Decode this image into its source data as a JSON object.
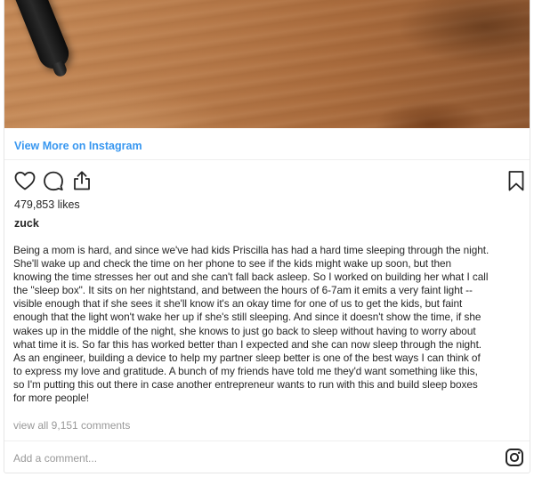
{
  "embed": {
    "view_more_label": "View More on Instagram",
    "likes_text": "479,853 likes",
    "username": "zuck",
    "caption": "Being a mom is hard, and since we've had kids Priscilla has had a hard time sleeping through the night.\nShe'll wake up and check the time on her phone to see if the kids might wake up soon, but then\nknowing the time stresses her out and she can't fall back asleep. So I worked on building her what I call\nthe \"sleep box\". It sits on her nightstand, and between the hours of 6-7am it emits a very faint light --\nvisible enough that if she sees it she'll know it's an okay time for one of us to get the kids, but faint\nenough that the light won't wake her up if she's still sleeping. And since it doesn't show the time, if she\nwakes up in the middle of the night, she knows to just go back to sleep without having to worry about\nwhat time it is. So far this has worked better than I expected and she can now sleep through the night.\nAs an engineer, building a device to help my partner sleep better is one of the best ways I can think of\nto express my love and gratitude. A bunch of my friends have told me they'd want something like this,\nso I'm putting this out there in case another entrepreneur wants to run with this and build sleep boxes\nfor more people!",
    "view_all_comments": "view all 9,151 comments",
    "comment_placeholder": "Add a comment..."
  },
  "icons": {
    "like": "heart-icon",
    "comment": "comment-bubble-icon",
    "share": "share-icon",
    "save": "bookmark-icon",
    "logo": "instagram-icon"
  },
  "colors": {
    "link": "#3897f0",
    "text": "#262626",
    "muted": "#999999",
    "border": "#e6e6e6"
  }
}
